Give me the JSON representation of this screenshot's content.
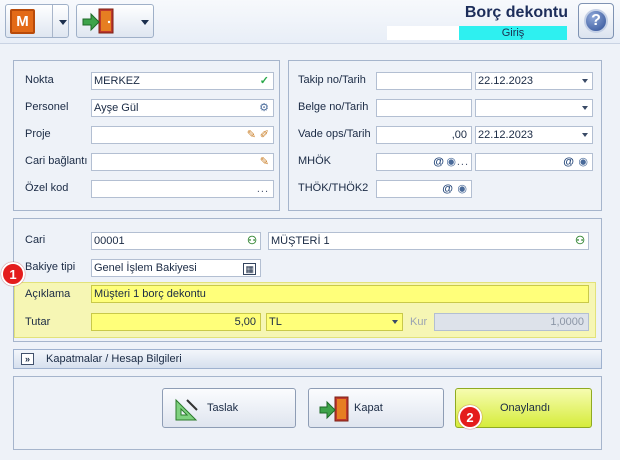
{
  "header": {
    "app_logo_letter": "M",
    "title": "Borç dekontu",
    "subtitle": "Giriş",
    "help_symbol": "?"
  },
  "top_left": {
    "nokta": {
      "label": "Nokta",
      "value": "MERKEZ"
    },
    "personel": {
      "label": "Personel",
      "value": "Ayşe Gül"
    },
    "proje": {
      "label": "Proje",
      "value": ""
    },
    "cari_baglanti": {
      "label": "Cari bağlantı",
      "value": ""
    },
    "ozel_kod": {
      "label": "Özel kod",
      "value": ""
    }
  },
  "top_right": {
    "takip": {
      "label": "Takip no/Tarih",
      "number": "",
      "date": "22.12.2023"
    },
    "belge": {
      "label": "Belge no/Tarih",
      "number": "",
      "date": ".  .        :  :"
    },
    "vade": {
      "label": "Vade ops/Tarih",
      "number": ",00",
      "date": "22.12.2023"
    },
    "mhok": {
      "label": "MHÖK",
      "value1": "",
      "value2": ""
    },
    "thok": {
      "label": "THÖK/THÖK2",
      "value": ""
    }
  },
  "bottom_form": {
    "cari": {
      "label": "Cari",
      "code": "00001",
      "name": "MÜŞTERİ 1"
    },
    "bakiye_tipi": {
      "label": "Bakiye tipi",
      "value": "Genel İşlem Bakiyesi"
    },
    "aciklama": {
      "label": "Açıklama",
      "value": "Müşteri 1 borç dekontu"
    },
    "tutar": {
      "label": "Tutar",
      "value": "5,00",
      "currency": "TL"
    },
    "kur": {
      "label": "Kur",
      "value": "1,0000"
    }
  },
  "collapse": {
    "expander_symbol": "»",
    "label": "Kapatmalar / Hesap Bilgileri"
  },
  "buttons": {
    "taslak": "Taslak",
    "kapat": "Kapat",
    "onaylandi": "Onaylandı"
  },
  "badges": {
    "one": "1",
    "two": "2"
  },
  "icons": {
    "ellipsis": "...",
    "check": "✓",
    "at": "@",
    "people": "👥"
  },
  "colors": {
    "highlight_yellow": "#ffff7a",
    "subtitle_cyan": "#2ef0f0",
    "approve_green": "#d6ec3b",
    "badge_red": "#e41c1c",
    "logo_orange": "#e36a17"
  }
}
